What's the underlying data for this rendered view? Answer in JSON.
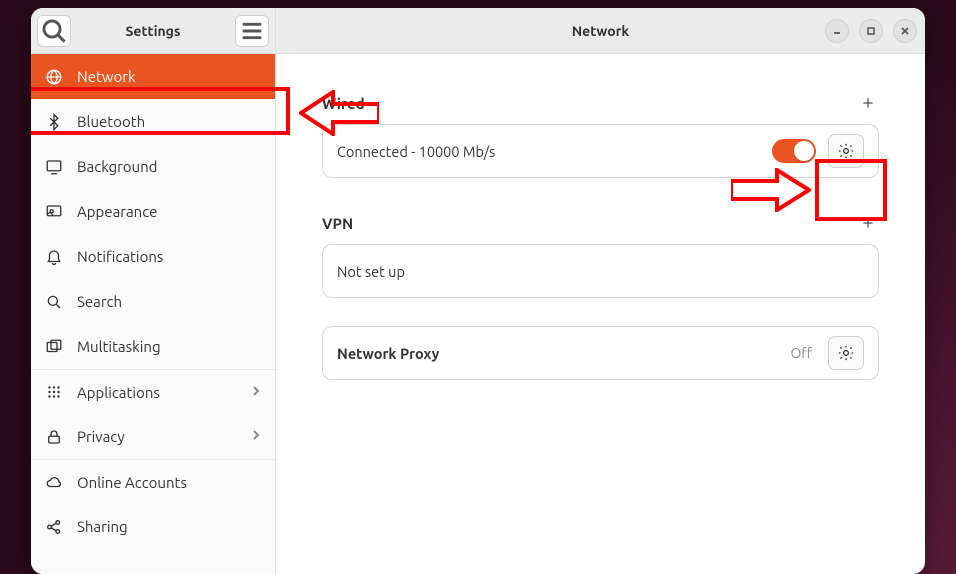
{
  "sidebar": {
    "title": "Settings",
    "items": [
      {
        "label": "Network",
        "icon": "globe",
        "selected": true
      },
      {
        "label": "Bluetooth",
        "icon": "bluetooth"
      },
      {
        "label": "Background",
        "icon": "display"
      },
      {
        "label": "Appearance",
        "icon": "appearance"
      },
      {
        "label": "Notifications",
        "icon": "bell"
      },
      {
        "label": "Search",
        "icon": "search"
      },
      {
        "label": "Multitasking",
        "icon": "multitasking"
      },
      {
        "label": "Applications",
        "icon": "grid",
        "chevron": true,
        "sep": true
      },
      {
        "label": "Privacy",
        "icon": "lock",
        "chevron": true
      },
      {
        "label": "Online Accounts",
        "icon": "cloud",
        "sep": true
      },
      {
        "label": "Sharing",
        "icon": "share"
      }
    ]
  },
  "main": {
    "title": "Network",
    "wired": {
      "heading": "Wired",
      "status": "Connected - 10000 Mb/s",
      "toggled": true
    },
    "vpn": {
      "heading": "VPN",
      "status": "Not set up"
    },
    "proxy": {
      "label": "Network Proxy",
      "state": "Off"
    }
  }
}
